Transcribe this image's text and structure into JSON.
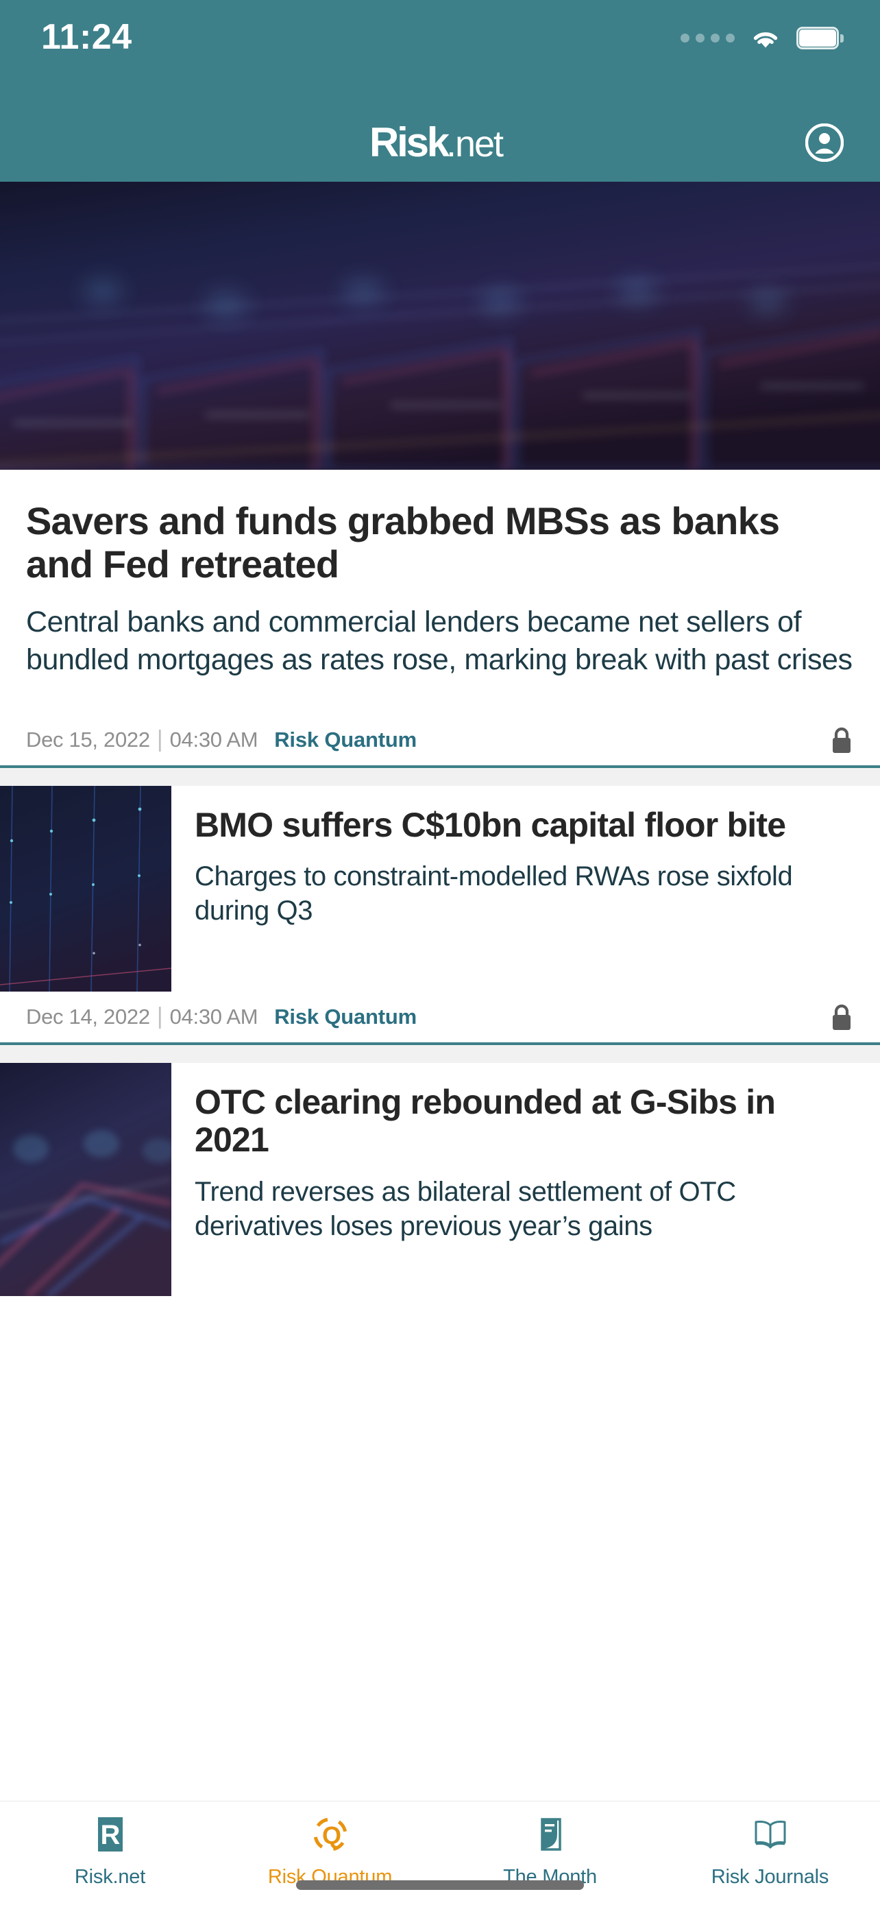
{
  "status_bar": {
    "time": "11:24",
    "signal_icon": "cellular-signal-dots-icon",
    "wifi_icon": "wifi-icon",
    "battery_icon": "battery-full-icon"
  },
  "header": {
    "brand_main": "Risk",
    "brand_suffix": ".net",
    "account_icon": "account-avatar-icon",
    "background_color": "#3d8089"
  },
  "lead_article": {
    "hero_image_alt": "blurred-financial-chart-image",
    "title": "Savers and funds grabbed MBSs as banks and Fed retreated",
    "standfirst": "Central banks and commercial lenders became net sellers of bundled mortgages as rates rose, marking break with past crises",
    "date": "Dec 15, 2022",
    "separator": "|",
    "time": "04:30 AM",
    "section": "Risk Quantum",
    "lock_icon": "padlock-locked-icon"
  },
  "articles": [
    {
      "thumb_alt": "dark-blue-data-grid-thumbnail",
      "title": "BMO suffers C$10bn capital floor bite",
      "standfirst": "Charges to constraint-modelled RWAs rose sixfold during Q3",
      "date": "Dec 14, 2022",
      "separator": "|",
      "time": "04:30 AM",
      "section": "Risk Quantum",
      "lock_icon": "padlock-locked-icon"
    },
    {
      "thumb_alt": "blurred-purple-chart-thumbnail",
      "title": "OTC clearing rebounded at G-Sibs in 2021",
      "standfirst": "Trend reverses as bilateral settlement of OTC derivatives loses previous year’s gains"
    }
  ],
  "tabbar": {
    "items": [
      {
        "label": "Risk.net",
        "icon": "risk-net-square-r-icon",
        "active": false,
        "color": "#2c6f82"
      },
      {
        "label": "Risk Quantum",
        "icon": "risk-quantum-q-icon",
        "active": true,
        "color": "#e8940f"
      },
      {
        "label": "The Month",
        "icon": "the-month-magazine-icon",
        "active": false,
        "color": "#2c6f82"
      },
      {
        "label": "Risk Journals",
        "icon": "risk-journals-book-icon",
        "active": false,
        "color": "#2c6f82"
      }
    ]
  },
  "theme": {
    "teal": "#3d8089",
    "teal_text": "#2c6f82",
    "orange": "#e8940f",
    "headline": "#262626",
    "standfirst": "#1d3b46",
    "meta_gray": "#8e8e8e"
  }
}
